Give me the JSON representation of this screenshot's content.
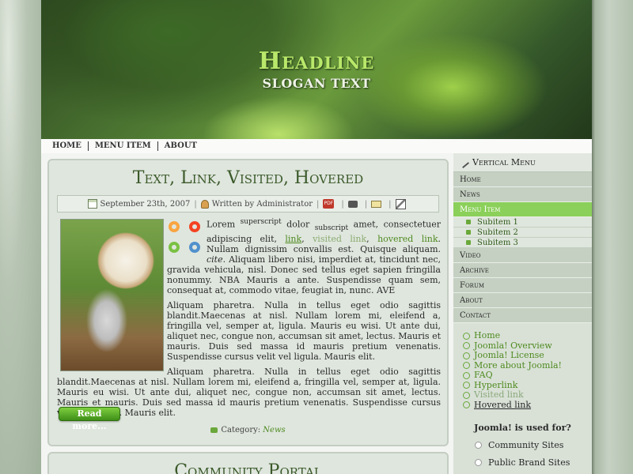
{
  "header": {
    "headline": "Headline",
    "slogan": "SLOGAN TEXT"
  },
  "topnav": {
    "items": [
      "HOME",
      "MENU ITEM",
      "ABOUT"
    ]
  },
  "article": {
    "title": "Text, Link, Visited, Hovered",
    "date": "September 23th, 2007",
    "author": "Written by Administrator",
    "pdf_label": "PDF",
    "p1": {
      "lorem": "Lorem ",
      "sup": "superscript",
      "dolor": " dolor ",
      "sub": "subscript",
      "rest": " amet, consectetuer adipiscing elit, ",
      "link": "link",
      "comma1": ", ",
      "visited": "visited link",
      "comma2": ", ",
      "hovered": "hovered link",
      "after": ". Nullam dignissim convallis est. Quisque aliquam. ",
      "cite": "cite",
      "tail": ". Aliquam libero nisi, imperdiet at, tincidunt nec, gravida vehicula, nisl. Donec sed tellus eget sapien fringilla nonummy. NBA Mauris a ante. Suspendisse quam sem, consequat at, commodo vitae, feugiat in, nunc. AVE"
    },
    "p2": "Aliquam pharetra. Nulla in tellus eget odio sagittis blandit.Maecenas at nisl. Nullam lorem mi, eleifend a, fringilla vel, semper at, ligula. Mauris eu wisi. Ut ante dui, aliquet nec, congue non, accumsan sit amet, lectus. Mauris et mauris. Duis sed massa id mauris pretium venenatis. Suspendisse cursus velit vel ligula. Mauris elit.",
    "p3": "Aliquam pharetra. Nulla in tellus eget odio sagittis blandit.Maecenas at nisl. Nullam lorem mi, eleifend a, fringilla vel, semper at, ligula. Mauris eu wisi. Ut ante dui, aliquet nec, congue non, accumsan sit amet, lectus. Mauris et mauris. Duis sed massa id mauris pretium venenatis. Suspendisse cursus velit vel ligula. Mauris elit.",
    "read_more": "Read more...",
    "category_label": "Category: ",
    "category_value": "News"
  },
  "article2": {
    "title": "Community Portal"
  },
  "vertical_menu": {
    "title": "Vertical Menu",
    "items": [
      "Home",
      "News",
      "Menu Item"
    ],
    "subitems": [
      "Subitem 1",
      "Subitem 2",
      "Subitem 3"
    ],
    "items_after": [
      "Video",
      "Archive",
      "Forum",
      "About",
      "Contact"
    ]
  },
  "links": [
    "Home",
    "Joomla! Overview",
    "Joomla! License",
    "More about Joomla!",
    "FAQ",
    "Hyperlink",
    "Visited link",
    "Hovered link"
  ],
  "poll": {
    "title": "Joomla! is used for?",
    "options": [
      "Community Sites",
      "Public Brand Sites"
    ]
  },
  "colors": {
    "accent": "#8bd05a",
    "link": "#4f8a20",
    "headline": "#b9e86a"
  }
}
